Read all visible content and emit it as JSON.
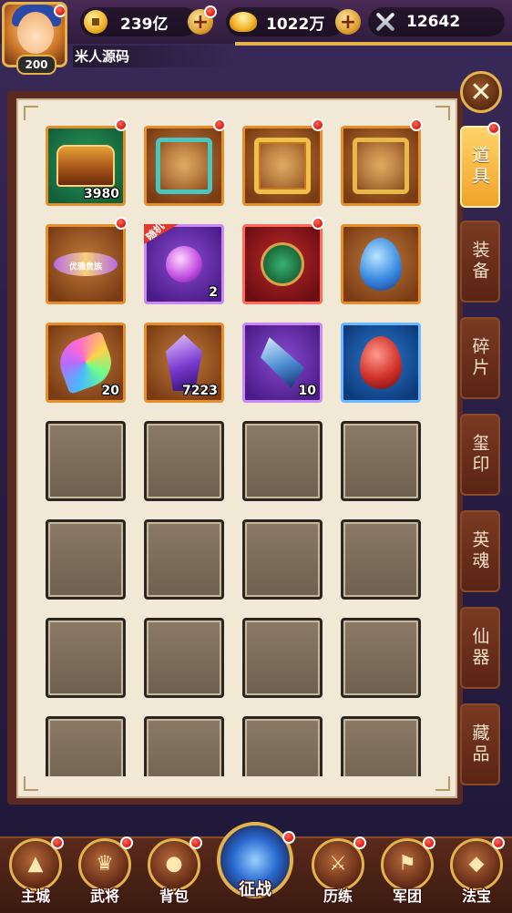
{
  "player": {
    "level": "200",
    "name": "米人源码"
  },
  "resources": {
    "copper": "239亿",
    "gold": "1022万",
    "power": "12642"
  },
  "icons": {
    "copper": "copper-coin-icon",
    "gold": "gold-ingot-icon",
    "power": "crossed-swords-icon",
    "plus": "plus-icon",
    "close": "close-icon"
  },
  "close_label": "✕",
  "side_tabs": [
    {
      "label": "道具",
      "active": true,
      "badge": true
    },
    {
      "label": "装备",
      "active": false,
      "badge": false
    },
    {
      "label": "碎片",
      "active": false,
      "badge": false
    },
    {
      "label": "玺印",
      "active": false,
      "badge": false
    },
    {
      "label": "英魂",
      "active": false,
      "badge": false
    },
    {
      "label": "仙器",
      "active": false,
      "badge": false
    },
    {
      "label": "藏品",
      "active": false,
      "badge": false
    }
  ],
  "items": [
    {
      "icon": "treasure-chest-icon",
      "count": "3980",
      "badge": true
    },
    {
      "icon": "teal-avatar-frame-icon",
      "count": "",
      "badge": true
    },
    {
      "icon": "dragon-avatar-frame-icon",
      "count": "",
      "badge": true
    },
    {
      "icon": "golden-avatar-frame-icon",
      "count": "",
      "badge": true
    },
    {
      "icon": "winged-title-icon",
      "count": "",
      "badge": true,
      "inner_text": "优雅贵族"
    },
    {
      "icon": "random-orb-icon",
      "count": "2",
      "badge": false,
      "tag": "随机"
    },
    {
      "icon": "jade-pendant-icon",
      "count": "",
      "badge": true
    },
    {
      "icon": "blue-egg-icon",
      "count": "",
      "badge": false
    },
    {
      "icon": "rainbow-leaf-icon",
      "count": "20",
      "badge": false
    },
    {
      "icon": "violet-crystal-icon",
      "count": "7223",
      "badge": false
    },
    {
      "icon": "ice-crystal-icon",
      "count": "10",
      "badge": false
    },
    {
      "icon": "red-egg-icon",
      "count": "",
      "badge": false
    }
  ],
  "bottom_nav": [
    {
      "label": "主城",
      "icon": "city-icon",
      "badge": true
    },
    {
      "label": "武将",
      "icon": "general-icon",
      "badge": true
    },
    {
      "label": "背包",
      "icon": "bag-icon",
      "badge": true
    },
    {
      "label": "征战",
      "icon": "battle-icon",
      "badge": true
    },
    {
      "label": "历练",
      "icon": "training-icon",
      "badge": true
    },
    {
      "label": "军团",
      "icon": "legion-icon",
      "badge": true
    },
    {
      "label": "法宝",
      "icon": "treasure-icon",
      "badge": true
    }
  ]
}
